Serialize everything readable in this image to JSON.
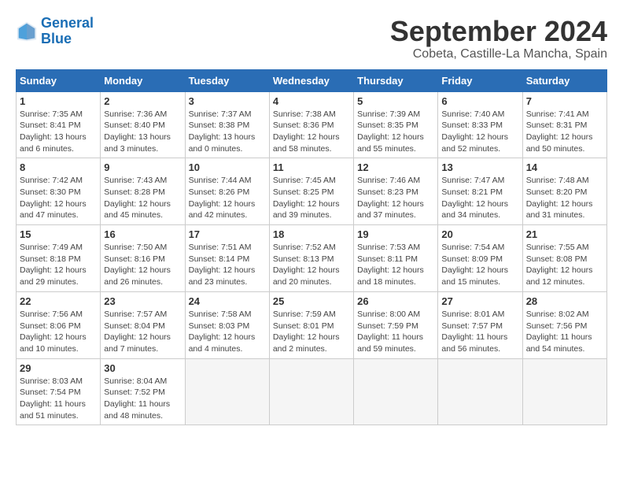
{
  "logo": {
    "line1": "General",
    "line2": "Blue"
  },
  "title": "September 2024",
  "location": "Cobeta, Castille-La Mancha, Spain",
  "headers": [
    "Sunday",
    "Monday",
    "Tuesday",
    "Wednesday",
    "Thursday",
    "Friday",
    "Saturday"
  ],
  "weeks": [
    [
      {
        "day": "1",
        "info": "Sunrise: 7:35 AM\nSunset: 8:41 PM\nDaylight: 13 hours\nand 6 minutes."
      },
      {
        "day": "2",
        "info": "Sunrise: 7:36 AM\nSunset: 8:40 PM\nDaylight: 13 hours\nand 3 minutes."
      },
      {
        "day": "3",
        "info": "Sunrise: 7:37 AM\nSunset: 8:38 PM\nDaylight: 13 hours\nand 0 minutes."
      },
      {
        "day": "4",
        "info": "Sunrise: 7:38 AM\nSunset: 8:36 PM\nDaylight: 12 hours\nand 58 minutes."
      },
      {
        "day": "5",
        "info": "Sunrise: 7:39 AM\nSunset: 8:35 PM\nDaylight: 12 hours\nand 55 minutes."
      },
      {
        "day": "6",
        "info": "Sunrise: 7:40 AM\nSunset: 8:33 PM\nDaylight: 12 hours\nand 52 minutes."
      },
      {
        "day": "7",
        "info": "Sunrise: 7:41 AM\nSunset: 8:31 PM\nDaylight: 12 hours\nand 50 minutes."
      }
    ],
    [
      {
        "day": "8",
        "info": "Sunrise: 7:42 AM\nSunset: 8:30 PM\nDaylight: 12 hours\nand 47 minutes."
      },
      {
        "day": "9",
        "info": "Sunrise: 7:43 AM\nSunset: 8:28 PM\nDaylight: 12 hours\nand 45 minutes."
      },
      {
        "day": "10",
        "info": "Sunrise: 7:44 AM\nSunset: 8:26 PM\nDaylight: 12 hours\nand 42 minutes."
      },
      {
        "day": "11",
        "info": "Sunrise: 7:45 AM\nSunset: 8:25 PM\nDaylight: 12 hours\nand 39 minutes."
      },
      {
        "day": "12",
        "info": "Sunrise: 7:46 AM\nSunset: 8:23 PM\nDaylight: 12 hours\nand 37 minutes."
      },
      {
        "day": "13",
        "info": "Sunrise: 7:47 AM\nSunset: 8:21 PM\nDaylight: 12 hours\nand 34 minutes."
      },
      {
        "day": "14",
        "info": "Sunrise: 7:48 AM\nSunset: 8:20 PM\nDaylight: 12 hours\nand 31 minutes."
      }
    ],
    [
      {
        "day": "15",
        "info": "Sunrise: 7:49 AM\nSunset: 8:18 PM\nDaylight: 12 hours\nand 29 minutes."
      },
      {
        "day": "16",
        "info": "Sunrise: 7:50 AM\nSunset: 8:16 PM\nDaylight: 12 hours\nand 26 minutes."
      },
      {
        "day": "17",
        "info": "Sunrise: 7:51 AM\nSunset: 8:14 PM\nDaylight: 12 hours\nand 23 minutes."
      },
      {
        "day": "18",
        "info": "Sunrise: 7:52 AM\nSunset: 8:13 PM\nDaylight: 12 hours\nand 20 minutes."
      },
      {
        "day": "19",
        "info": "Sunrise: 7:53 AM\nSunset: 8:11 PM\nDaylight: 12 hours\nand 18 minutes."
      },
      {
        "day": "20",
        "info": "Sunrise: 7:54 AM\nSunset: 8:09 PM\nDaylight: 12 hours\nand 15 minutes."
      },
      {
        "day": "21",
        "info": "Sunrise: 7:55 AM\nSunset: 8:08 PM\nDaylight: 12 hours\nand 12 minutes."
      }
    ],
    [
      {
        "day": "22",
        "info": "Sunrise: 7:56 AM\nSunset: 8:06 PM\nDaylight: 12 hours\nand 10 minutes."
      },
      {
        "day": "23",
        "info": "Sunrise: 7:57 AM\nSunset: 8:04 PM\nDaylight: 12 hours\nand 7 minutes."
      },
      {
        "day": "24",
        "info": "Sunrise: 7:58 AM\nSunset: 8:03 PM\nDaylight: 12 hours\nand 4 minutes."
      },
      {
        "day": "25",
        "info": "Sunrise: 7:59 AM\nSunset: 8:01 PM\nDaylight: 12 hours\nand 2 minutes."
      },
      {
        "day": "26",
        "info": "Sunrise: 8:00 AM\nSunset: 7:59 PM\nDaylight: 11 hours\nand 59 minutes."
      },
      {
        "day": "27",
        "info": "Sunrise: 8:01 AM\nSunset: 7:57 PM\nDaylight: 11 hours\nand 56 minutes."
      },
      {
        "day": "28",
        "info": "Sunrise: 8:02 AM\nSunset: 7:56 PM\nDaylight: 11 hours\nand 54 minutes."
      }
    ],
    [
      {
        "day": "29",
        "info": "Sunrise: 8:03 AM\nSunset: 7:54 PM\nDaylight: 11 hours\nand 51 minutes."
      },
      {
        "day": "30",
        "info": "Sunrise: 8:04 AM\nSunset: 7:52 PM\nDaylight: 11 hours\nand 48 minutes."
      },
      {
        "day": "",
        "info": ""
      },
      {
        "day": "",
        "info": ""
      },
      {
        "day": "",
        "info": ""
      },
      {
        "day": "",
        "info": ""
      },
      {
        "day": "",
        "info": ""
      }
    ]
  ]
}
